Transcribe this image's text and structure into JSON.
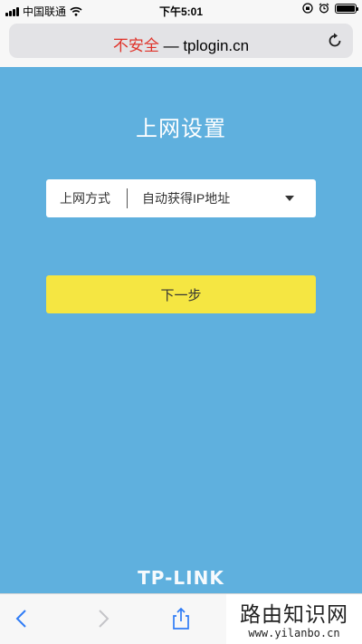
{
  "status_bar": {
    "carrier": "中国联通",
    "time": "下午5:01"
  },
  "url_bar": {
    "insecure_label": "不安全",
    "separator": " — ",
    "domain": "tplogin.cn"
  },
  "page": {
    "title": "上网设置",
    "connection_type": {
      "label": "上网方式",
      "selected_value": "自动获得IP地址"
    },
    "next_button_label": "下一步",
    "brand": "TP-LINK"
  },
  "watermark": {
    "title": "路由知识网",
    "url": "www.yilanbo.cn"
  },
  "colors": {
    "page_background": "#5fb0de",
    "button_yellow": "#f5e642",
    "insecure_red": "#e0332a",
    "toolbar_icon_blue": "#2f7cf6"
  }
}
